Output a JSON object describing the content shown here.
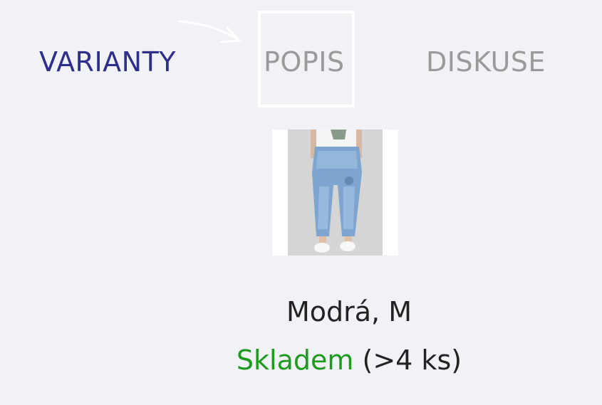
{
  "tabs": [
    {
      "label": "VARIANTY",
      "active": true
    },
    {
      "label": "POPIS",
      "active": false
    },
    {
      "label": "DISKUSE",
      "active": false
    }
  ],
  "colors": {
    "background": "#f0f2f6",
    "active_tab": "#2d2f8a",
    "inactive_tab": "#9a9a9a",
    "in_stock": "#1e9b1e",
    "text": "#222222"
  },
  "variant": {
    "name": "Modrá, M",
    "stock_label": "Skladem",
    "stock_count": "(>4 ks)",
    "image_icon": "jeans-product-thumbnail"
  },
  "annotation": {
    "arrow_icon": "arrow-right-icon",
    "highlight": "POPIS"
  }
}
